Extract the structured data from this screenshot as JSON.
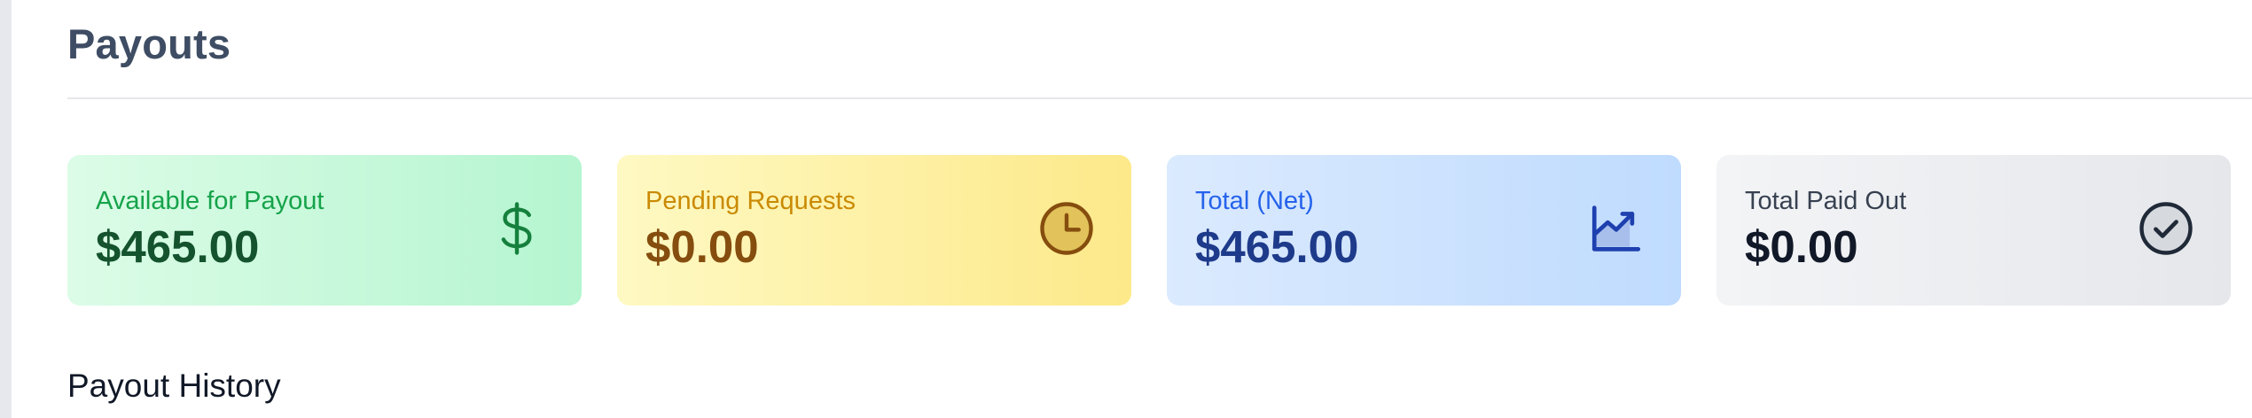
{
  "page": {
    "title": "Payouts"
  },
  "cards": [
    {
      "label": "Available for Payout",
      "value": "$465.00",
      "icon": "dollar-icon"
    },
    {
      "label": "Pending Requests",
      "value": "$0.00",
      "icon": "clock-icon"
    },
    {
      "label": "Total (Net)",
      "value": "$465.00",
      "icon": "chart-trend-icon"
    },
    {
      "label": "Total Paid Out",
      "value": "$0.00",
      "icon": "check-circle-icon"
    }
  ],
  "history": {
    "title": "Payout History"
  },
  "colors": {
    "green_accent": "#16a34a",
    "yellow_accent": "#ca8a04",
    "blue_accent": "#2563eb",
    "gray_accent": "#374151"
  }
}
